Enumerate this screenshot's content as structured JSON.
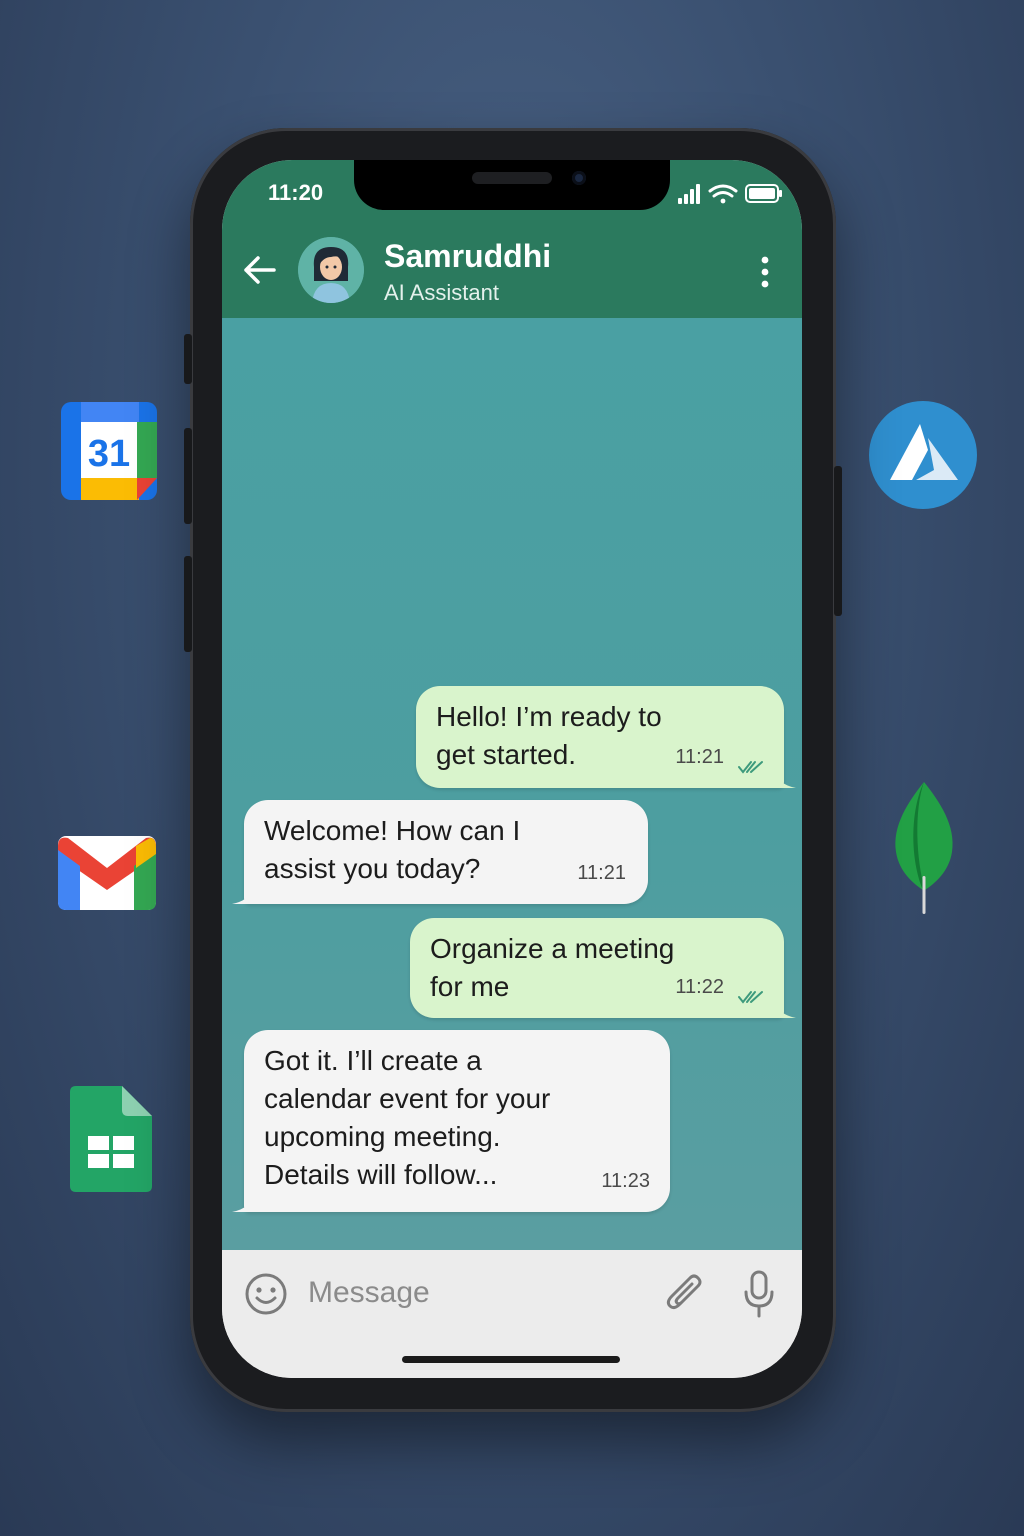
{
  "status_bar": {
    "time": "11:20"
  },
  "header": {
    "contact_name": "Samruddhi",
    "contact_status": "AI Assistant"
  },
  "messages": [
    {
      "direction": "outgoing",
      "text": "Hello! I’m ready to\nget started.",
      "time": "11:21",
      "read": true
    },
    {
      "direction": "incoming",
      "text": "Welcome! How can I\nassist you today?",
      "time": "11:21"
    },
    {
      "direction": "outgoing",
      "text": "Organize a meeting\nfor me",
      "time": "11:22",
      "read": true
    },
    {
      "direction": "incoming",
      "text": "Got it. I’ll create a\ncalendar event for your\nupcoming meeting.\nDetails will follow...",
      "time": "11:23"
    }
  ],
  "input": {
    "placeholder": "Message",
    "value": ""
  },
  "floating_apps": {
    "left": [
      "calendar-icon",
      "gmail-icon",
      "sheets-icon"
    ],
    "right": [
      "azure-icon",
      "mongodb-icon"
    ],
    "calendar_day": "31"
  },
  "colors": {
    "header": "#2b7a5e",
    "chat_background": "#4aa0a3",
    "outgoing_bubble": "#d9f4cc",
    "incoming_bubble": "#f4f4f4",
    "read_ticks": "#3d9a7c"
  }
}
